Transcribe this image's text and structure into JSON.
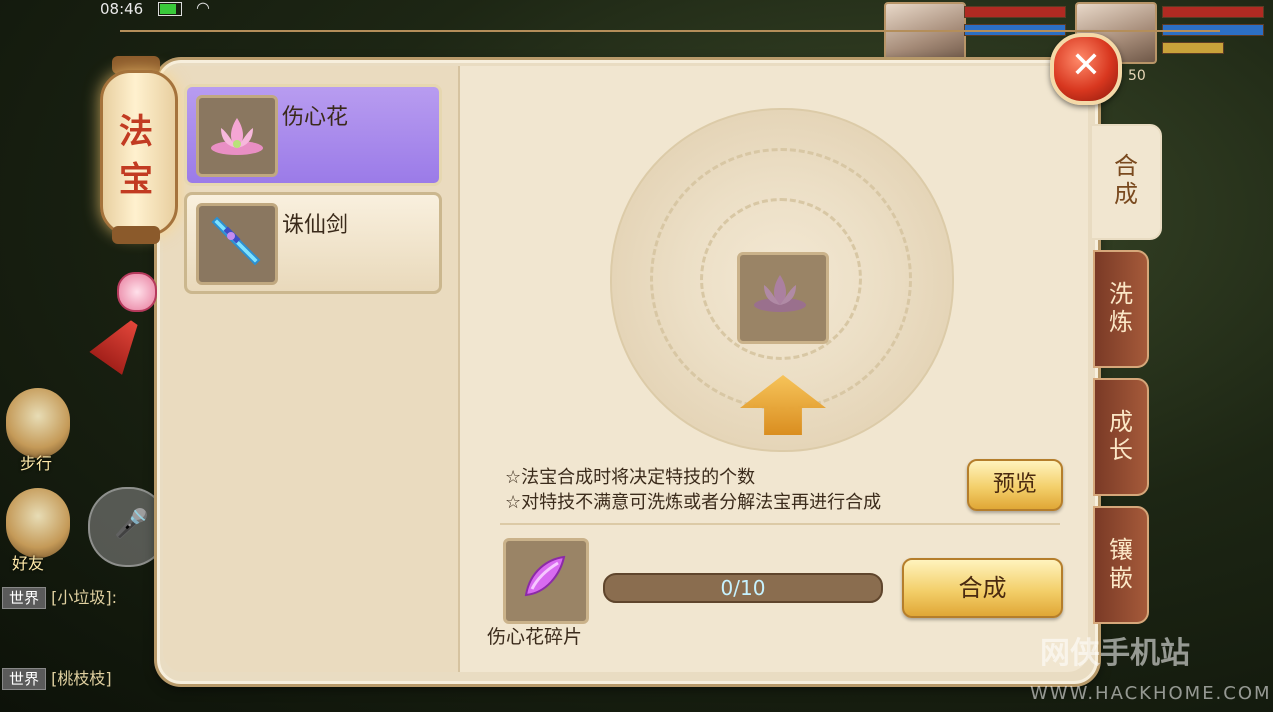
{
  "status_bar": {
    "time": "08:46"
  },
  "hud": {
    "level": "50"
  },
  "side": {
    "walk_label": "步行",
    "friends_label": "好友"
  },
  "chat": [
    {
      "tag": "世界",
      "text": "[小垃圾]:"
    },
    {
      "tag": "世界",
      "text": "[桃枝枝]"
    }
  ],
  "lantern": {
    "title": "法宝"
  },
  "tabs": [
    {
      "label": "合成",
      "active": true
    },
    {
      "label": "洗炼",
      "active": false
    },
    {
      "label": "成长",
      "active": false
    },
    {
      "label": "镶嵌",
      "active": false
    }
  ],
  "items": [
    {
      "name": "伤心花",
      "icon": "lotus-icon",
      "selected": true
    },
    {
      "name": "诛仙剑",
      "icon": "sword-icon",
      "selected": false
    }
  ],
  "hints": [
    "☆法宝合成时将决定特技的个数",
    "☆对特技不满意可洗炼或者分解法宝再进行合成"
  ],
  "buttons": {
    "preview": "预览",
    "compose": "合成",
    "close": "✕"
  },
  "fragment": {
    "name": "伤心花碎片",
    "progress_text": "0/10",
    "progress_fraction": 0.0
  },
  "watermark": {
    "brand": "网侠手机站",
    "url": "WWW.HACKHOME.COM"
  },
  "colors": {
    "selected_item": "#9b7be8",
    "close_button": "#d8371f",
    "gold_button": "#f3cf6a"
  }
}
